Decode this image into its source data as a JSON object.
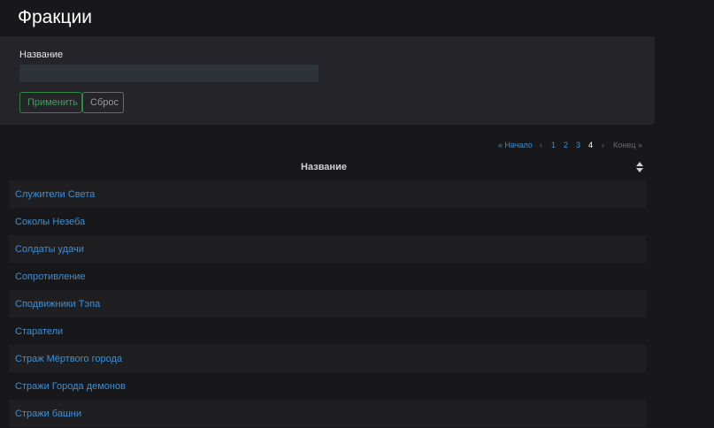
{
  "page": {
    "title": "Фракции"
  },
  "filter": {
    "label": "Название",
    "input_value": "",
    "apply_label": "Применить",
    "reset_label": "Сброс"
  },
  "pagination": {
    "first": "« Начало",
    "prev": "‹",
    "pages": [
      "1",
      "2",
      "3",
      "4"
    ],
    "current": "4",
    "next": "›",
    "last": "Конец »"
  },
  "table": {
    "header": "Название",
    "rows": [
      "Служители Света",
      "Соколы Незеба",
      "Солдаты удачи",
      "Сопротивление",
      "Сподвижники Тэпа",
      "Старатели",
      "Страж Мёртвого города",
      "Стражи Города демонов",
      "Стражи башни"
    ]
  },
  "colors": {
    "background": "#18181b",
    "panel": "#252529",
    "link": "#3d8fd6",
    "apply_accent": "#3aa55a"
  }
}
